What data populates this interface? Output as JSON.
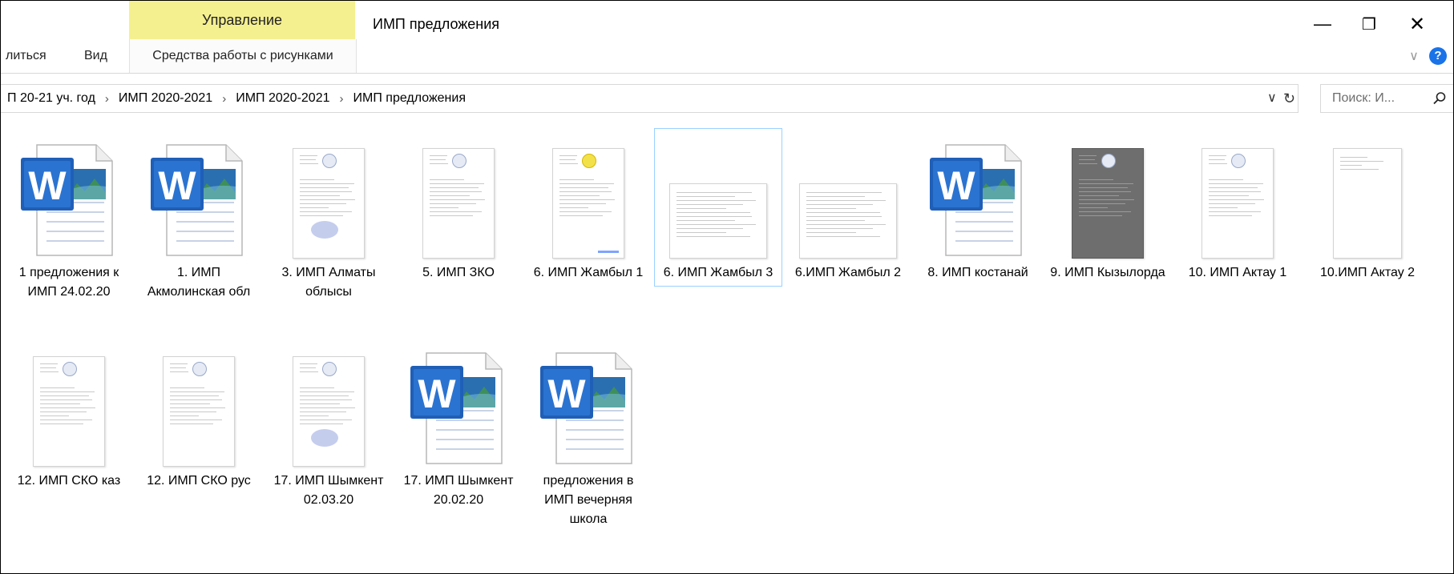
{
  "titlebar": {
    "context_tab_header": "Управление",
    "window_title": "ИМП предложения",
    "minimize_glyph": "—",
    "restore_glyph": "❐",
    "close_glyph": "✕"
  },
  "ribbon": {
    "tabs": [
      {
        "label": "литься"
      },
      {
        "label": "Вид"
      },
      {
        "label": "Средства работы с рисунками"
      }
    ],
    "expand_glyph": "∨",
    "help_glyph": "?"
  },
  "address": {
    "crumbs": [
      "П 20-21 уч. год",
      "ИМП 2020-2021",
      "ИМП 2020-2021",
      "ИМП предложения"
    ],
    "separator": "›",
    "dropdown_glyph": "∨",
    "refresh_glyph": "↻"
  },
  "search": {
    "placeholder": "Поиск: И...",
    "icon": "search-icon"
  },
  "files": [
    {
      "name": "1 предложения к ИМП 24.02.20",
      "type": "word"
    },
    {
      "name": "1. ИМП Акмолинская обл",
      "type": "word"
    },
    {
      "name": "3. ИМП Алматы облысы",
      "type": "scan-stamp"
    },
    {
      "name": "5. ИМП ЗКО",
      "type": "scan"
    },
    {
      "name": "6. ИМП Жамбыл 1",
      "type": "scan-yellow"
    },
    {
      "name": "6. ИМП Жамбыл 3",
      "type": "landscape",
      "selected": true
    },
    {
      "name": "6.ИМП Жамбыл 2",
      "type": "landscape"
    },
    {
      "name": "8. ИМП костанай",
      "type": "word"
    },
    {
      "name": "9. ИМП Кызылорда",
      "type": "dark"
    },
    {
      "name": "10. ИМП Актау 1",
      "type": "scan"
    },
    {
      "name": "10.ИМП Актау 2",
      "type": "blank"
    },
    {
      "name": "12. ИМП СКО каз",
      "type": "scan"
    },
    {
      "name": "12. ИМП СКО рус",
      "type": "scan"
    },
    {
      "name": "17. ИМП Шымкент 02.03.20",
      "type": "scan-stamp"
    },
    {
      "name": "17. ИМП Шымкент 20.02.20",
      "type": "word"
    },
    {
      "name": "предложения в ИМП вечерняя школа",
      "type": "word"
    }
  ],
  "colors": {
    "context_tab": "#f5f08f",
    "word_blue": "#1f5fb8",
    "selection_border": "#99d1ff",
    "help_blue": "#1a73e8"
  }
}
